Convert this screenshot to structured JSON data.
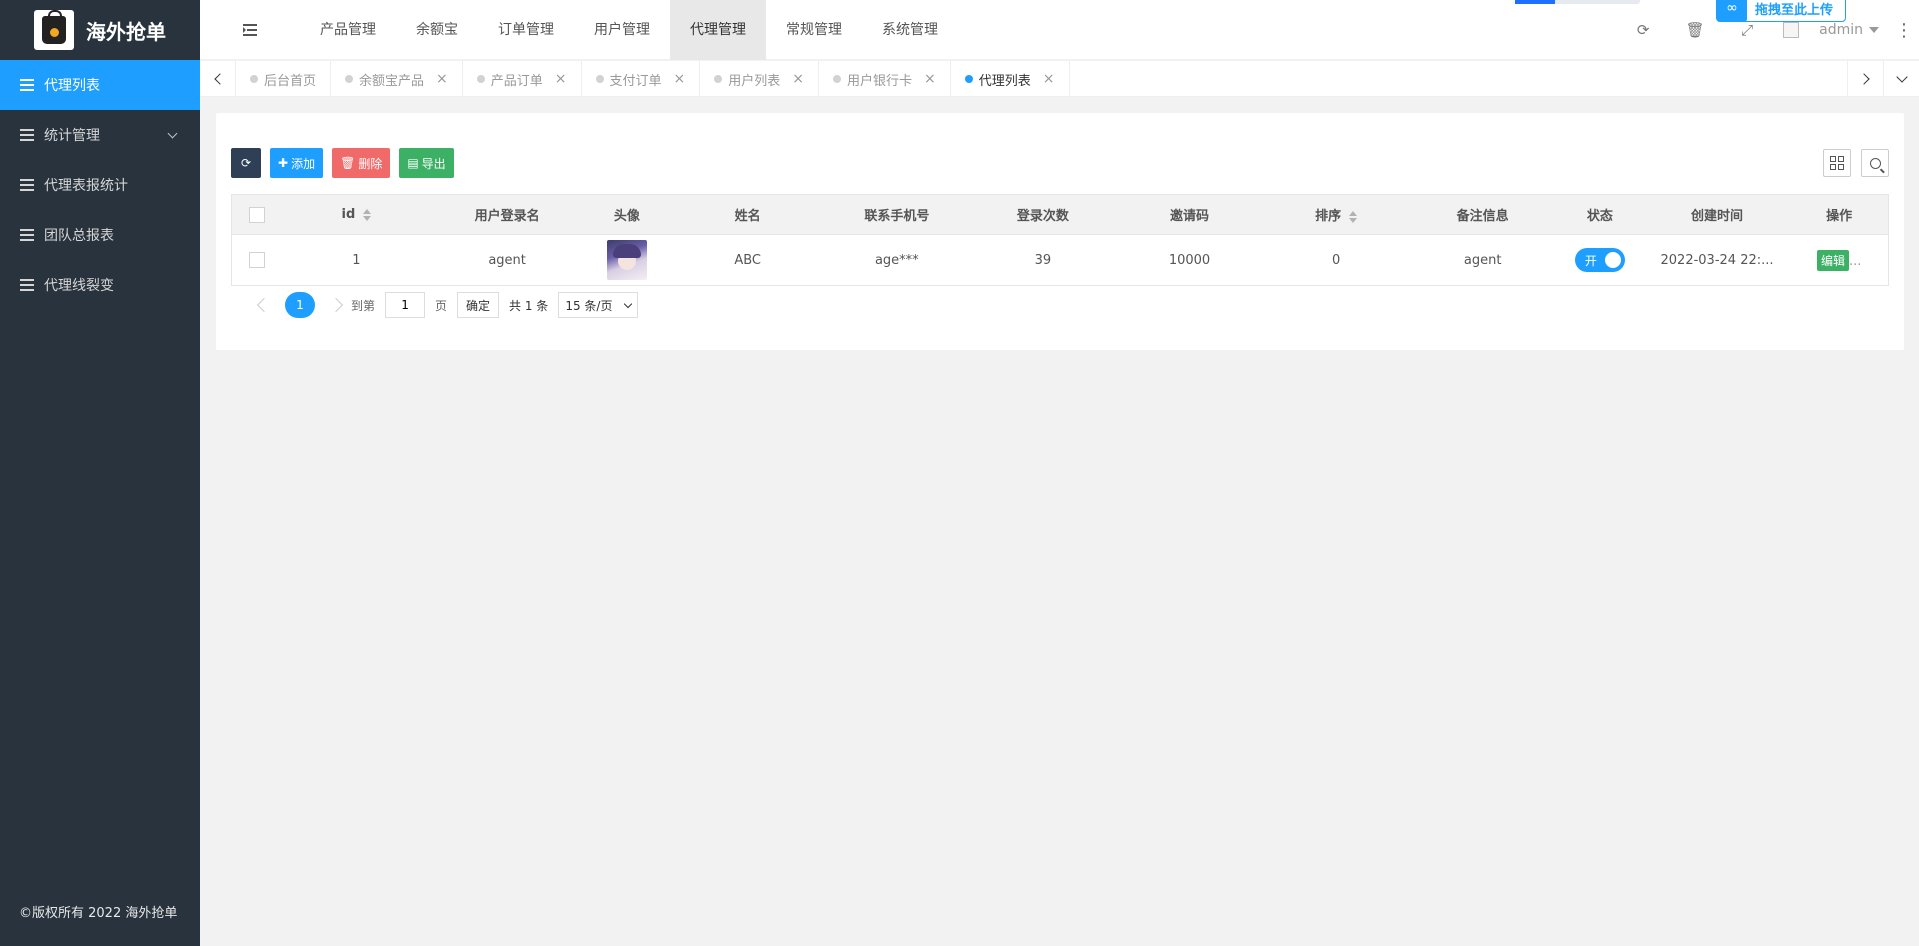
{
  "app": {
    "name": "海外抢单",
    "copyright": "©版权所有 2022 海外抢单"
  },
  "sidebar": {
    "items": [
      {
        "label": "代理列表",
        "active": true
      },
      {
        "label": "统计管理",
        "has_children": true
      },
      {
        "label": "代理表报统计"
      },
      {
        "label": "团队总报表"
      },
      {
        "label": "代理线裂变"
      }
    ]
  },
  "topnav": {
    "items": [
      "产品管理",
      "余额宝",
      "订单管理",
      "用户管理",
      "代理管理",
      "常规管理",
      "系统管理"
    ],
    "active": "代理管理"
  },
  "header": {
    "user": "admin",
    "upload_label": "拖拽至此上传"
  },
  "tabs": [
    {
      "label": "后台首页",
      "closable": false
    },
    {
      "label": "余额宝产品",
      "closable": true
    },
    {
      "label": "产品订单",
      "closable": true
    },
    {
      "label": "支付订单",
      "closable": true
    },
    {
      "label": "用户列表",
      "closable": true
    },
    {
      "label": "用户银行卡",
      "closable": true
    },
    {
      "label": "代理列表",
      "closable": true,
      "active": true
    }
  ],
  "toolbar": {
    "add": "添加",
    "delete": "删除",
    "export": "导出"
  },
  "table": {
    "headers": [
      "id",
      "用户登录名",
      "头像",
      "姓名",
      "联系手机号",
      "登录次数",
      "邀请码",
      "排序",
      "备注信息",
      "状态",
      "创建时间",
      "操作"
    ],
    "rows": [
      {
        "id": "1",
        "login": "agent",
        "name": "ABC",
        "phone": "age***",
        "logins": "39",
        "invite": "10000",
        "sort": "0",
        "remark": "agent",
        "status": "开",
        "created": "2022-03-24 22:...",
        "action": "编辑",
        "more": "..."
      }
    ]
  },
  "pager": {
    "current": "1",
    "goto_label": "到第",
    "page_input": "1",
    "page_unit": "页",
    "confirm": "确定",
    "total": "共 1 条",
    "page_size": "15 条/页"
  },
  "colors": {
    "primary": "#1e9fff",
    "sidebar": "#28333e",
    "green": "#3cb065",
    "red": "#f06a6a",
    "dark": "#2f4056"
  }
}
